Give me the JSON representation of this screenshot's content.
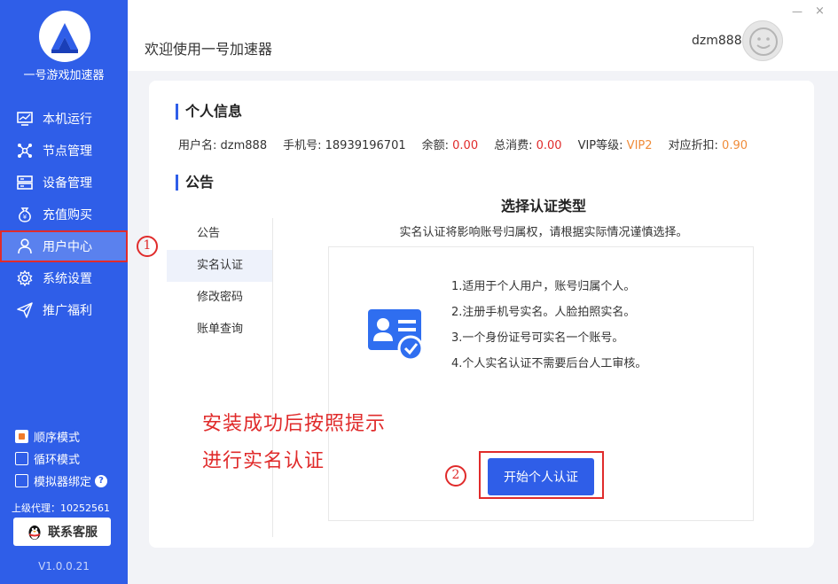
{
  "app": {
    "name": "一号游戏加速器",
    "version": "V1.0.0.21"
  },
  "sidebar": {
    "items": [
      {
        "label": "本机运行",
        "icon": "monitor-icon"
      },
      {
        "label": "节点管理",
        "icon": "network-icon"
      },
      {
        "label": "设备管理",
        "icon": "server-icon"
      },
      {
        "label": "充值购买",
        "icon": "money-bag-icon"
      },
      {
        "label": "用户中心",
        "icon": "user-icon",
        "active": true
      },
      {
        "label": "系统设置",
        "icon": "gear-icon"
      },
      {
        "label": "推广福利",
        "icon": "send-icon"
      }
    ],
    "options": [
      {
        "label": "顺序模式",
        "checked": true
      },
      {
        "label": "循环模式",
        "checked": false
      },
      {
        "label": "模拟器绑定",
        "checked": false
      }
    ],
    "agent": "上级代理：10252561",
    "service_button": "联系客服"
  },
  "header": {
    "welcome": "欢迎使用一号加速器",
    "username": "dzm888",
    "minimize": "—",
    "close": "×"
  },
  "profile": {
    "section_title": "个人信息",
    "fields": [
      {
        "label": "用户名:",
        "value": "dzm888",
        "color": "#333333"
      },
      {
        "label": "手机号:",
        "value": "18939196701",
        "color": "#333333"
      },
      {
        "label": "余额:",
        "value": "0.00",
        "color": "#e02b2b"
      },
      {
        "label": "总消费:",
        "value": "0.00",
        "color": "#e02b2b"
      },
      {
        "label": "VIP等级:",
        "value": "VIP2",
        "color": "#f08c3a"
      },
      {
        "label": "对应折扣:",
        "value": "0.90",
        "color": "#f08c3a"
      }
    ]
  },
  "notice": {
    "section_title": "公告",
    "tabs": [
      "公告",
      "实名认证",
      "修改密码",
      "账单查询"
    ],
    "active_tab": 1
  },
  "verify": {
    "title": "选择认证类型",
    "subtitle": "实名认证将影响账号归属权，请根据实际情况谨慎选择。",
    "rules": [
      "1.适用于个人用户，账号归属个人。",
      "2.注册手机号实名。人脸拍照实名。",
      "3.一个身份证号可实名一个账号。",
      "4.个人实名认证不需要后台人工审核。"
    ],
    "start_button": "开始个人认证"
  },
  "annotations": {
    "marker_1": "1",
    "marker_2": "2",
    "line1": "安装成功后按照提示",
    "line2": "进行实名认证"
  },
  "colors": {
    "accent": "#2f5ee8",
    "highlight": "#e02b2b"
  }
}
